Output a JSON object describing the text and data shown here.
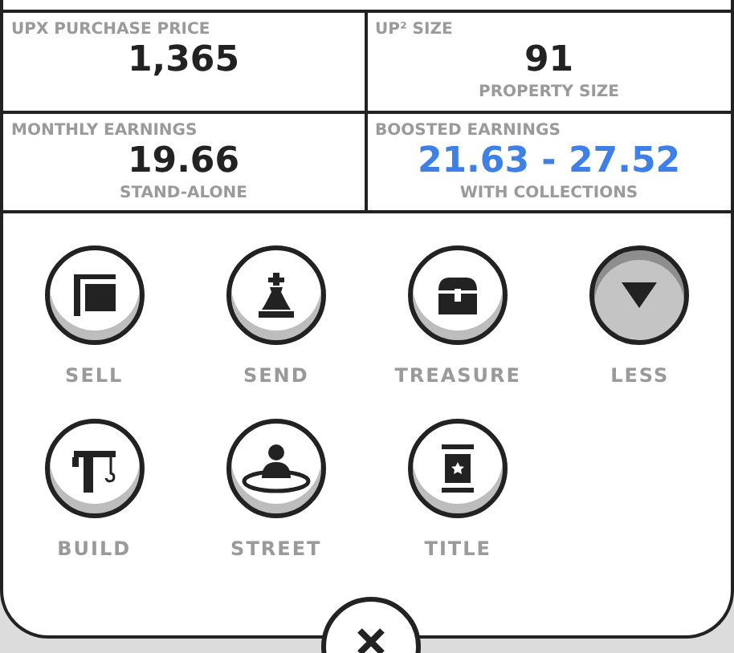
{
  "stats": [
    {
      "label": "UPX PURCHASE PRICE",
      "value": "1,365",
      "highlight": false
    },
    {
      "label": "UP² SIZE",
      "value": "91",
      "caption": "PROPERTY SIZE",
      "highlight": false
    },
    {
      "label": "MONTHLY EARNINGS",
      "value": "19.66",
      "caption": "STAND-ALONE",
      "highlight": false
    },
    {
      "label": "BOOSTED EARNINGS",
      "value": "21.63 - 27.52",
      "caption": "WITH COLLECTIONS",
      "highlight": true
    }
  ],
  "actions": [
    {
      "label": "SELL",
      "kind": "action"
    },
    {
      "label": "SEND",
      "kind": "action"
    },
    {
      "label": "TREASURE",
      "kind": "action"
    },
    {
      "label": "LESS",
      "kind": "toggle"
    },
    {
      "label": "BUILD",
      "kind": "action"
    },
    {
      "label": "STREET",
      "kind": "action"
    },
    {
      "label": "TITLE",
      "kind": "action"
    }
  ]
}
